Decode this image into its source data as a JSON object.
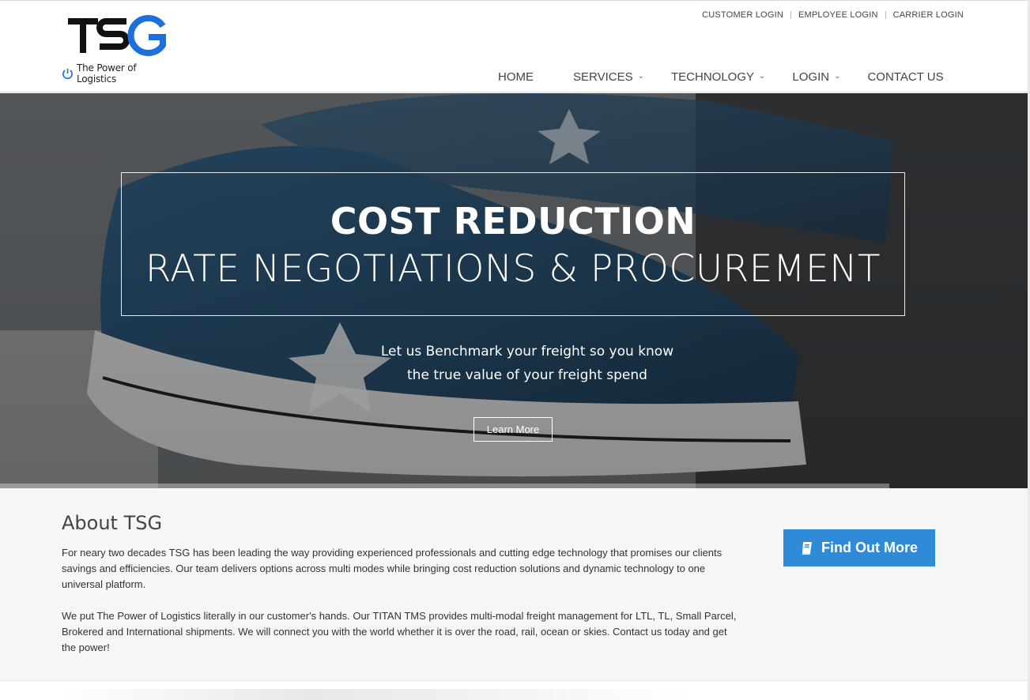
{
  "header": {
    "logo_tagline": "The Power of Logistics",
    "top_links": [
      "CUSTOMER LOGIN",
      "EMPLOYEE LOGIN",
      "CARRIER LOGIN"
    ],
    "nav": [
      {
        "label": "HOME",
        "dropdown": false
      },
      {
        "label": "SERVICES",
        "dropdown": true
      },
      {
        "label": "TECHNOLOGY",
        "dropdown": true
      },
      {
        "label": "LOGIN",
        "dropdown": true
      },
      {
        "label": "CONTACT US",
        "dropdown": false
      }
    ]
  },
  "hero": {
    "title": "COST REDUCTION",
    "subtitle": "RATE NEGOTIATIONS & PROCUREMENT",
    "text_line1": "Let us Benchmark your freight so you know",
    "text_line2": "the true value of your freight spend",
    "button_label": "Learn More"
  },
  "about": {
    "title": "About TSG",
    "paragraph1": "For neary two decades TSG has been leading the way providing experienced professionals and cutting edge technology that promises our clients savings and efficiencies. Our team delivers options across multi modes while bringing cost reduction solutions and dynamic technology to one universal platform.",
    "paragraph2": "We put The Power of Logistics literally in our customer's hands. Our TITAN TMS provides multi-modal freight management for LTL, TL, Small Parcel, Brokered and International shipments. We will connect you with the world whether it is over the road, rail, ocean or skies. Contact us today and get the power!",
    "button_label": "Find Out More",
    "button_icon": "book-icon"
  },
  "colors": {
    "accent_blue": "#2f8bd8",
    "logo_blue": "#1e6fd9",
    "text_dark": "#333333"
  }
}
